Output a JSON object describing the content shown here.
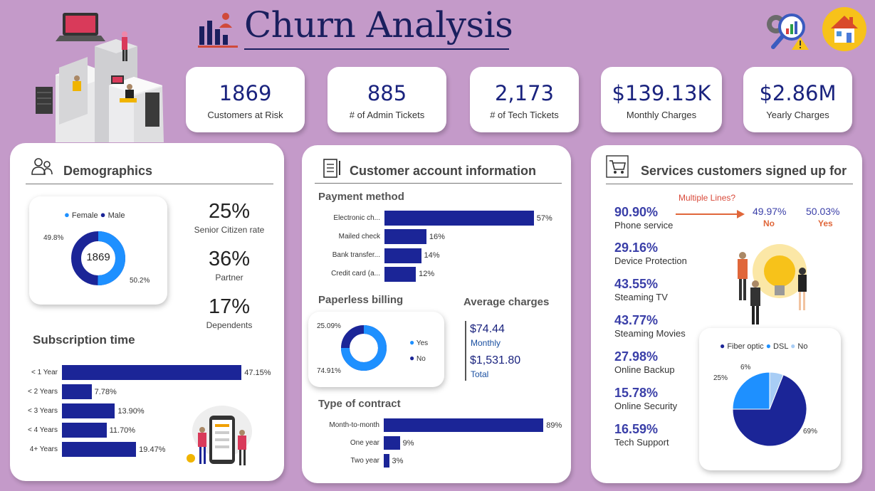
{
  "header": {
    "title": "Churn Analysis"
  },
  "kpis": [
    {
      "value": "1869",
      "label": "Customers at Risk"
    },
    {
      "value": "885",
      "label": "# of Admin Tickets"
    },
    {
      "value": "2,173",
      "label": "# of Tech Tickets"
    },
    {
      "value": "$139.13K",
      "label": "Monthly Charges"
    },
    {
      "value": "$2.86M",
      "label": "Yearly Charges"
    }
  ],
  "demographics": {
    "title": "Demographics",
    "donut": {
      "legend": [
        "Female",
        "Male"
      ],
      "center": "1869",
      "female_label": "50.2%",
      "male_label": "49.8%",
      "female_share": 50.2,
      "male_share": 49.8,
      "colors": {
        "female": "#1e90ff",
        "male": "#1b2597"
      }
    },
    "stats": [
      {
        "value": "25%",
        "label": "Senior Citizen rate"
      },
      {
        "value": "36%",
        "label": "Partner"
      },
      {
        "value": "17%",
        "label": "Dependents"
      }
    ],
    "subscription_title": "Subscription time"
  },
  "account": {
    "title": "Customer account information",
    "payment_title": "Payment method",
    "paperless_title": "Paperless billing",
    "paperless": {
      "legend": [
        "Yes",
        "No"
      ],
      "yes_label": "74.91%",
      "no_label": "25.09%",
      "yes_share": 74.91,
      "no_share": 25.09,
      "colors": {
        "yes": "#1e90ff",
        "no": "#1b2597"
      }
    },
    "avg_title": "Average charges",
    "avg_monthly_value": "$74.44",
    "avg_monthly_label": "Monthly",
    "avg_total_value": "$1,531.80",
    "avg_total_label": "Total",
    "contract_title": "Type of contract"
  },
  "services": {
    "title": "Services customers signed up for",
    "multiple_lines_label": "Multiple Lines?",
    "multi_no_value": "49.97%",
    "multi_no_label": "No",
    "multi_yes_value": "50.03%",
    "multi_yes_label": "Yes",
    "list": [
      {
        "value": "90.90%",
        "label": "Phone service"
      },
      {
        "value": "29.16%",
        "label": "Device Protection"
      },
      {
        "value": "43.55%",
        "label": "Steaming TV"
      },
      {
        "value": "43.77%",
        "label": "Steaming Movies"
      },
      {
        "value": "27.98%",
        "label": "Online Backup"
      },
      {
        "value": "15.78%",
        "label": "Online Security"
      },
      {
        "value": "16.59%",
        "label": "Tech Support"
      }
    ],
    "internet_pie": {
      "legend": [
        "Fiber optic",
        "DSL",
        "No"
      ],
      "labels": [
        "69%",
        "25%",
        "6%"
      ],
      "values": [
        69,
        25,
        6
      ],
      "colors": [
        "#1b2597",
        "#1e90ff",
        "#a8cdf5"
      ]
    }
  },
  "chart_data": [
    {
      "type": "bar",
      "title": "Subscription time",
      "categories": [
        "< 1 Year",
        "< 2 Years",
        "< 3 Years",
        "< 4 Years",
        "4+ Years"
      ],
      "values": [
        47.15,
        7.78,
        13.9,
        11.7,
        19.47
      ],
      "labels": [
        "47.15%",
        "7.78%",
        "13.90%",
        "11.70%",
        "19.47%"
      ]
    },
    {
      "type": "bar",
      "title": "Payment method",
      "categories": [
        "Electronic ch...",
        "Mailed check",
        "Bank transfer...",
        "Credit card (a..."
      ],
      "values": [
        57,
        16,
        14,
        12
      ],
      "labels": [
        "57%",
        "16%",
        "14%",
        "12%"
      ]
    },
    {
      "type": "bar",
      "title": "Type of contract",
      "categories": [
        "Month-to-month",
        "One year",
        "Two year"
      ],
      "values": [
        89,
        9,
        3
      ],
      "labels": [
        "89%",
        "9%",
        "3%"
      ]
    }
  ]
}
